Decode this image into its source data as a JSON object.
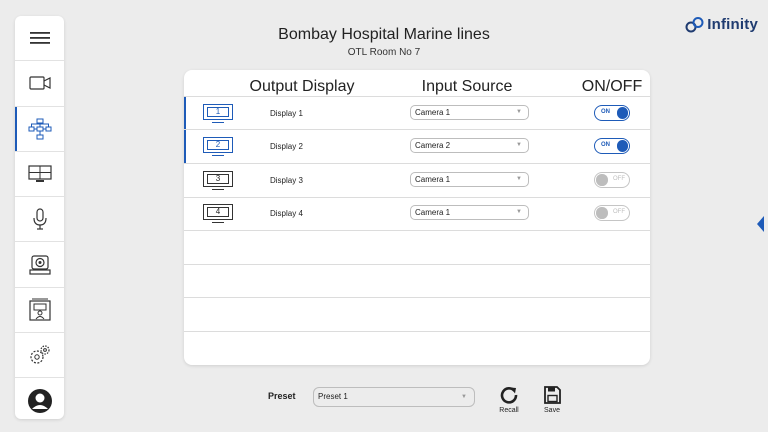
{
  "header": {
    "title": "Bombay Hospital Marine lines",
    "subtitle": "OTL Room No 7"
  },
  "logo": {
    "text": "Infinity"
  },
  "sidebar": {
    "items": [
      {
        "icon": "menu-icon",
        "active": false
      },
      {
        "icon": "camera-icon",
        "active": false
      },
      {
        "icon": "network-icon",
        "active": true
      },
      {
        "icon": "display-grid-icon",
        "active": false
      },
      {
        "icon": "microphone-icon",
        "active": false
      },
      {
        "icon": "ptz-camera-icon",
        "active": false
      },
      {
        "icon": "room-icon",
        "active": false
      },
      {
        "icon": "settings-icon",
        "active": false
      },
      {
        "icon": "user-icon",
        "active": false
      }
    ]
  },
  "table": {
    "headers": {
      "output": "Output Display",
      "input": "Input Source",
      "onoff": "ON/OFF"
    },
    "rows": [
      {
        "number": "1",
        "name": "Display 1",
        "source": "Camera 1",
        "state": "ON",
        "selected": true
      },
      {
        "number": "2",
        "name": "Display 2",
        "source": "Camera 2",
        "state": "ON",
        "selected": true
      },
      {
        "number": "3",
        "name": "Display 3",
        "source": "Camera 1",
        "state": "OFF",
        "selected": false
      },
      {
        "number": "4",
        "name": "Display 4",
        "source": "Camera 1",
        "state": "OFF",
        "selected": false
      }
    ]
  },
  "preset": {
    "label": "Preset",
    "value": "Preset 1",
    "recall_label": "Recall",
    "save_label": "Save"
  },
  "colors": {
    "accent": "#1e5bb8",
    "background": "#ececec"
  }
}
